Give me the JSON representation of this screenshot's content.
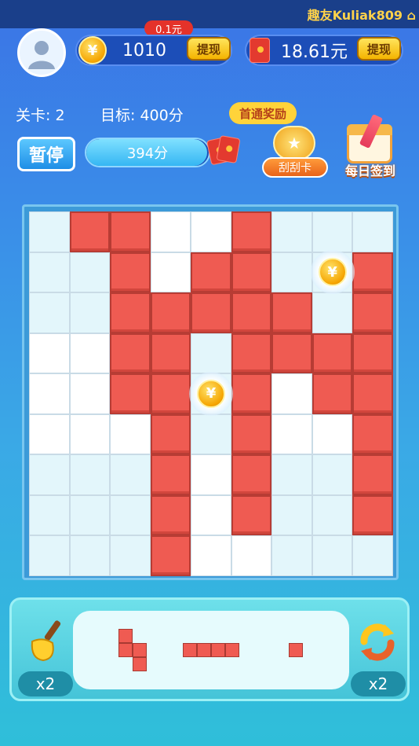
{
  "marquee": {
    "text": "趣友Kuliak809 ⌂"
  },
  "header": {
    "coins": "1010",
    "coin_symbol": "¥",
    "withdraw_label": "提现",
    "top_bubble": "0.1元",
    "cash": "18.61元"
  },
  "info": {
    "level": "关卡: 2",
    "target": "目标: 400分"
  },
  "controls": {
    "pause_label": "暂停",
    "score": "394分",
    "score_progress": 0.985,
    "first_reward": "首通奖励",
    "scratch_label": "刮刮卡",
    "checkin_label": "每日签到"
  },
  "board": {
    "rows": 9,
    "cols": 9,
    "light_blocks": [
      [
        0,
        0
      ],
      [
        0,
        6
      ],
      [
        0,
        7
      ],
      [
        0,
        8
      ],
      [
        1,
        0
      ],
      [
        1,
        1
      ],
      [
        1,
        6
      ],
      [
        1,
        7
      ],
      [
        2,
        0
      ],
      [
        2,
        1
      ],
      [
        2,
        6
      ],
      [
        2,
        7
      ],
      [
        3,
        4
      ],
      [
        4,
        4
      ],
      [
        5,
        4
      ],
      [
        6,
        0
      ],
      [
        6,
        1
      ],
      [
        6,
        2
      ],
      [
        6,
        6
      ],
      [
        6,
        7
      ],
      [
        6,
        8
      ],
      [
        7,
        0
      ],
      [
        7,
        1
      ],
      [
        7,
        2
      ],
      [
        7,
        6
      ],
      [
        7,
        7
      ],
      [
        7,
        8
      ],
      [
        8,
        0
      ],
      [
        8,
        1
      ],
      [
        8,
        2
      ],
      [
        8,
        6
      ],
      [
        8,
        7
      ],
      [
        8,
        8
      ]
    ],
    "red_cells": [
      [
        0,
        1
      ],
      [
        0,
        2
      ],
      [
        0,
        5
      ],
      [
        1,
        2
      ],
      [
        1,
        4
      ],
      [
        1,
        5
      ],
      [
        1,
        8
      ],
      [
        2,
        2
      ],
      [
        2,
        3
      ],
      [
        2,
        4
      ],
      [
        2,
        5
      ],
      [
        2,
        6
      ],
      [
        2,
        8
      ],
      [
        3,
        2
      ],
      [
        3,
        3
      ],
      [
        3,
        5
      ],
      [
        3,
        6
      ],
      [
        3,
        7
      ],
      [
        3,
        8
      ],
      [
        4,
        2
      ],
      [
        4,
        3
      ],
      [
        4,
        5
      ],
      [
        4,
        7
      ],
      [
        4,
        8
      ],
      [
        5,
        3
      ],
      [
        5,
        5
      ],
      [
        5,
        8
      ],
      [
        6,
        3
      ],
      [
        6,
        5
      ],
      [
        6,
        8
      ],
      [
        7,
        3
      ],
      [
        7,
        5
      ],
      [
        7,
        8
      ],
      [
        8,
        3
      ]
    ],
    "coins": [
      [
        1,
        7
      ],
      [
        4,
        4
      ]
    ]
  },
  "tray": {
    "shovel_count": "x2",
    "refresh_count": "x2",
    "pieces": [
      {
        "cells": [
          [
            0,
            0
          ],
          [
            1,
            0
          ],
          [
            1,
            1
          ],
          [
            2,
            1
          ]
        ]
      },
      {
        "cells": [
          [
            0,
            0
          ],
          [
            0,
            1
          ],
          [
            0,
            2
          ],
          [
            0,
            3
          ]
        ]
      },
      {
        "cells": [
          [
            0,
            0
          ]
        ]
      }
    ]
  }
}
